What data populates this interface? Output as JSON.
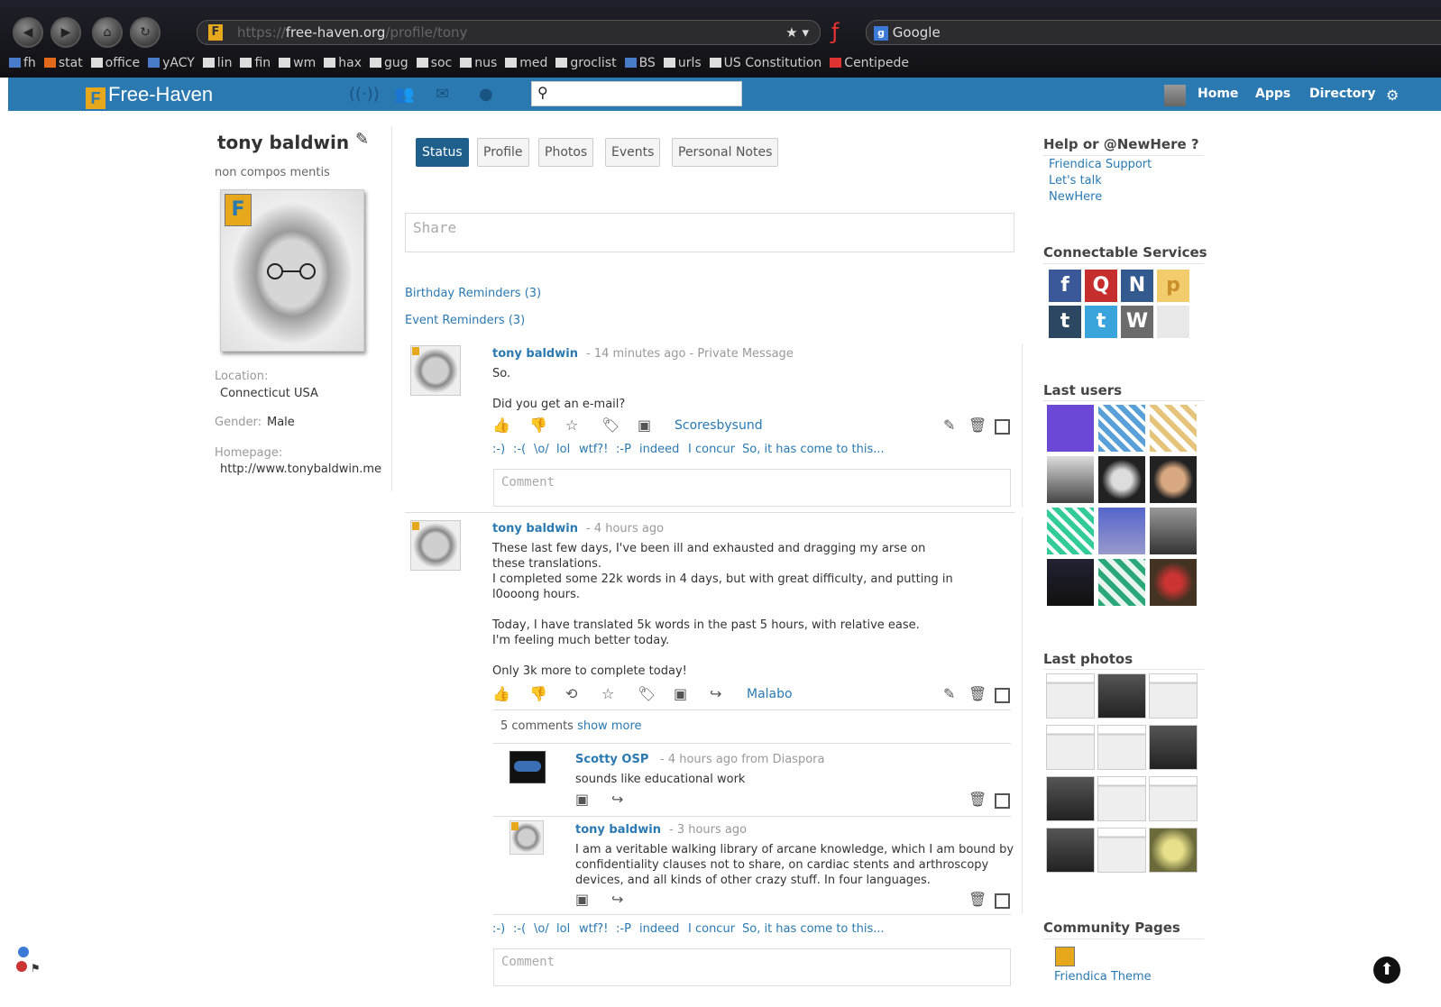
{
  "browser": {
    "url_host": "free-haven.org",
    "url_scheme": "https://",
    "url_path": "/profile/tony",
    "search_engine": "Google",
    "bookmarks": [
      "fh",
      "stat",
      "office",
      "yACY",
      "lin",
      "fin",
      "wm",
      "hax",
      "gug",
      "soc",
      "nus",
      "med",
      "groclist",
      "BS",
      "urls",
      "US Constitution",
      "Centipede"
    ]
  },
  "app": {
    "logo": "Free-Haven",
    "nav": {
      "home": "Home",
      "apps": "Apps",
      "directory": "Directory"
    }
  },
  "profile": {
    "name": "tony baldwin",
    "tagline": "non compos mentis",
    "location_label": "Location:",
    "location": "Connecticut USA",
    "gender_label": "Gender:",
    "gender": "Male",
    "homepage_label": "Homepage:",
    "homepage": "http://www.tonybaldwin.me"
  },
  "tabs": [
    "Status",
    "Profile",
    "Photos",
    "Events",
    "Personal Notes"
  ],
  "share_placeholder": "Share",
  "reminders": {
    "birthday": "Birthday Reminders (3)",
    "event": "Event Reminders (3)"
  },
  "posts": [
    {
      "author": "tony baldwin",
      "meta": "- 14 minutes ago - Private Message",
      "lines": [
        "So.",
        "",
        "Did you get an e-mail?"
      ],
      "tag": "Scoresbysund"
    },
    {
      "author": "tony baldwin",
      "meta": "- 4 hours ago",
      "lines": [
        "These last few days, I've been ill and exhausted and dragging my arse on",
        "these translations.",
        "I completed some 22k words in 4 days, but with great difficulty, and putting in",
        "l0ooong hours.",
        "",
        "Today, I have translated 5k words in the past 5 hours, with relative ease.",
        "I'm feeling much better today.",
        "",
        "Only 3k more to complete today!"
      ],
      "tag": "Malabo",
      "comment_count": "5 comments",
      "show_more": "show more",
      "comments": [
        {
          "author": "Scotty OSP",
          "meta": "- 4 hours ago from Diaspora",
          "lines": [
            "sounds like educational work"
          ]
        },
        {
          "author": "tony baldwin",
          "meta": "- 3 hours ago",
          "lines": [
            "I am a veritable walking library of arcane knowledge, which I am bound by",
            "confidentiality clauses not to share, on cardiac stents and arthroscopy",
            "devices, and all kinds of other crazy stuff. In four languages."
          ]
        }
      ]
    }
  ],
  "emotes": [
    ":-)",
    ":-(",
    "\\o/",
    "lol",
    "wtf?!",
    ":-P",
    "indeed",
    "I concur",
    "So, it has come to this..."
  ],
  "comment_placeholder": "Comment",
  "right": {
    "help_title": "Help or @NewHere ?",
    "help_links": [
      "Friendica Support",
      "Let's talk",
      "NewHere"
    ],
    "services_title": "Connectable Services",
    "services": [
      {
        "name": "facebook-icon",
        "glyph": "f",
        "color": "#3b5998"
      },
      {
        "name": "quora-icon",
        "glyph": "Q",
        "color": "#c62d2d"
      },
      {
        "name": "statusnet-icon",
        "glyph": "N",
        "color": "#335a8f"
      },
      {
        "name": "posterous-icon",
        "glyph": "p",
        "color": "#f3cc6e"
      },
      {
        "name": "tumblr-icon",
        "glyph": "t",
        "color": "#2c4762"
      },
      {
        "name": "twitter-icon",
        "glyph": "t",
        "color": "#3aa5dd"
      },
      {
        "name": "wordpress-icon",
        "glyph": "W",
        "color": "#6b6b6b"
      },
      {
        "name": "email-icon",
        "glyph": "",
        "color": "#e8e8e8"
      }
    ],
    "users_title": "Last users",
    "photos_title": "Last photos",
    "community_title": "Community Pages",
    "community_link": "Friendica Theme"
  }
}
